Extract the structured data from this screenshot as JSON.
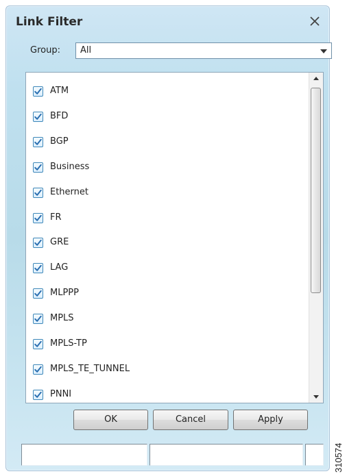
{
  "dialog": {
    "title": "Link Filter",
    "close_icon": "close-icon"
  },
  "group": {
    "label": "Group:",
    "selected": "All"
  },
  "list": {
    "items": [
      {
        "label": "ATM",
        "checked": true
      },
      {
        "label": "BFD",
        "checked": true
      },
      {
        "label": "BGP",
        "checked": true
      },
      {
        "label": "Business",
        "checked": true
      },
      {
        "label": "Ethernet",
        "checked": true
      },
      {
        "label": "FR",
        "checked": true
      },
      {
        "label": "GRE",
        "checked": true
      },
      {
        "label": "LAG",
        "checked": true
      },
      {
        "label": "MLPPP",
        "checked": true
      },
      {
        "label": "MPLS",
        "checked": true
      },
      {
        "label": "MPLS-TP",
        "checked": true
      },
      {
        "label": "MPLS_TE_TUNNEL",
        "checked": true
      },
      {
        "label": "PNNI",
        "checked": true
      }
    ]
  },
  "buttons": {
    "ok": "OK",
    "cancel": "Cancel",
    "apply": "Apply"
  },
  "figure_id": "310574",
  "colors": {
    "check_mark": "#2b6fb0",
    "dialog_bg": "#bfe0ef"
  }
}
